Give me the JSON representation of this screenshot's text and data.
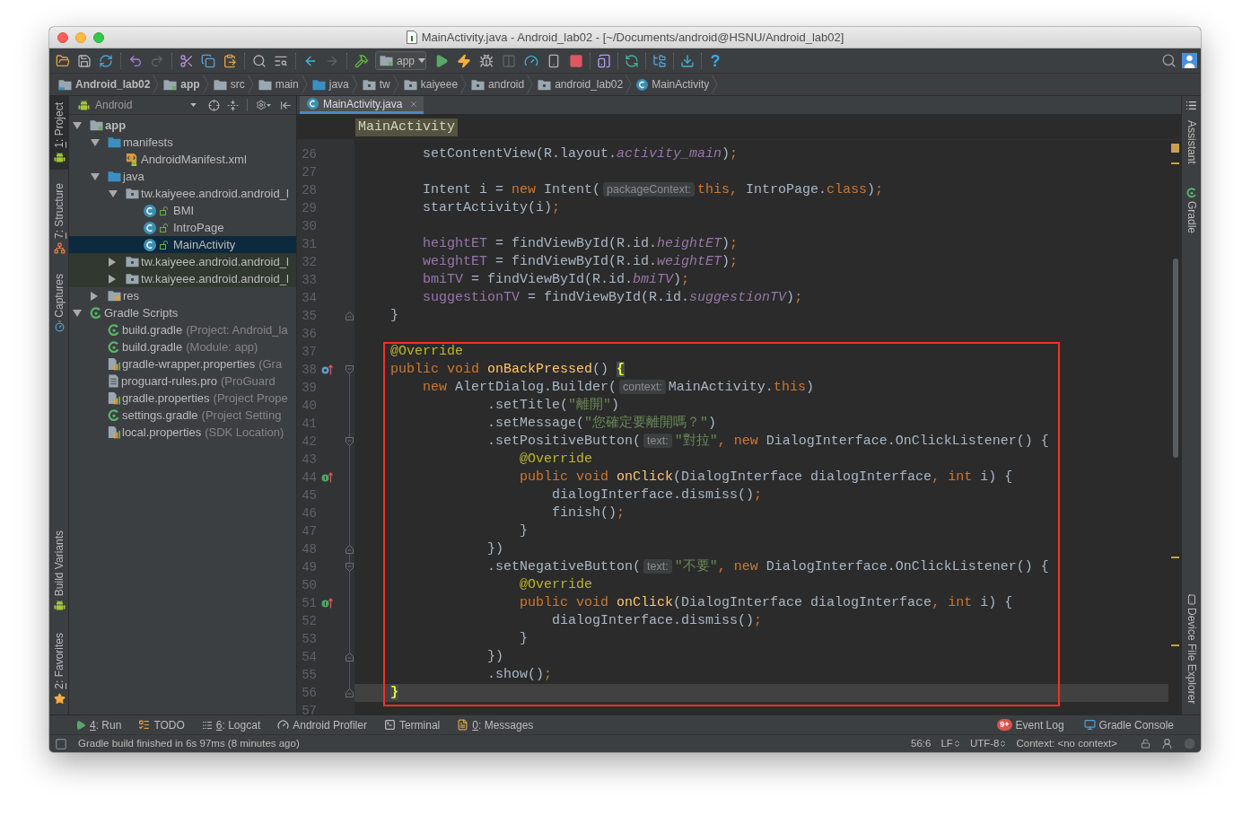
{
  "window": {
    "title": "MainActivity.java - Android_lab02 - [~/Documents/android@HSNU/Android_lab02]"
  },
  "toolbar": {
    "run_configuration": "app",
    "help": "?"
  },
  "navigation_bar": [
    {
      "kind": "project",
      "label": "Android_lab02"
    },
    {
      "kind": "module",
      "label": "app"
    },
    {
      "kind": "folder",
      "label": "src"
    },
    {
      "kind": "folder",
      "label": "main"
    },
    {
      "kind": "source-folder",
      "label": "java"
    },
    {
      "kind": "package",
      "label": "tw"
    },
    {
      "kind": "package",
      "label": "kaiyeee"
    },
    {
      "kind": "package",
      "label": "android"
    },
    {
      "kind": "package",
      "label": "android_lab02"
    },
    {
      "kind": "class",
      "label": "MainActivity"
    }
  ],
  "left_tool_strip": {
    "top": [
      {
        "kind": "project",
        "mnemonic": "1",
        "label": ": Project",
        "selected": true
      },
      {
        "kind": "structure",
        "mnemonic": "7",
        "label": ": Structure",
        "selected": false
      },
      {
        "kind": "captures",
        "label": "Captures",
        "selected": false
      }
    ],
    "bottom": [
      {
        "kind": "build-variants",
        "label": "Build Variants",
        "selected": false
      },
      {
        "kind": "favorites",
        "mnemonic": "2",
        "label": ": Favorites",
        "selected": false
      }
    ]
  },
  "project_panel": {
    "view": "Android",
    "tree": [
      {
        "kind": "module",
        "label": "app",
        "selected": false,
        "expanded": true,
        "children": [
          {
            "kind": "source-folder",
            "label": "manifests",
            "selected": false,
            "expanded": true,
            "children": [
              {
                "kind": "manifest",
                "label": "AndroidManifest.xml",
                "selected": false
              }
            ]
          },
          {
            "kind": "source-folder",
            "label": "java",
            "selected": false,
            "expanded": true,
            "children": [
              {
                "kind": "package",
                "label": "tw.kaiyeee.android.android_l",
                "selected": false,
                "expanded": true,
                "children": [
                  {
                    "kind": "class",
                    "label": "BMI",
                    "selected": false
                  },
                  {
                    "kind": "class",
                    "label": "IntroPage",
                    "selected": false
                  },
                  {
                    "kind": "class",
                    "label": "MainActivity",
                    "selected": true
                  }
                ]
              },
              {
                "kind": "test-package",
                "label": "tw.kaiyeee.android.android_l",
                "selected": false,
                "expanded": false
              },
              {
                "kind": "test-package",
                "label": "tw.kaiyeee.android.android_l",
                "selected": false,
                "expanded": false
              }
            ]
          },
          {
            "kind": "resource-folder",
            "label": "res",
            "selected": false,
            "expanded": false
          }
        ]
      },
      {
        "kind": "gradle-group",
        "label": "Gradle Scripts",
        "selected": false,
        "expanded": true,
        "children": [
          {
            "kind": "gradle",
            "label": "build.gradle",
            "note": "(Project: Android_la",
            "selected": false
          },
          {
            "kind": "gradle",
            "label": "build.gradle",
            "note": "(Module: app)",
            "selected": false
          },
          {
            "kind": "properties",
            "label": "gradle-wrapper.properties",
            "note": "(Gra",
            "selected": false
          },
          {
            "kind": "file",
            "label": "proguard-rules.pro",
            "note": "(ProGuard",
            "selected": false
          },
          {
            "kind": "properties",
            "label": "gradle.properties",
            "note": "(Project Prope",
            "selected": false
          },
          {
            "kind": "gradle",
            "label": "settings.gradle",
            "note": "(Project Setting",
            "selected": false
          },
          {
            "kind": "properties",
            "label": "local.properties",
            "note": "(SDK Location)",
            "selected": false
          }
        ]
      }
    ]
  },
  "editor": {
    "tabs": [
      {
        "label": "MainActivity.java",
        "selected": true
      }
    ],
    "header": "MainActivity",
    "lines": [
      {
        "number": "26",
        "current": false,
        "tokens": [
          {
            "kind": "text",
            "text": "        setContentView(R.layout."
          },
          {
            "kind": "static",
            "text": "activity_main"
          },
          {
            "kind": "text",
            "text": ")"
          },
          {
            "kind": "keyword",
            "text": ";"
          }
        ]
      },
      {
        "number": "27",
        "current": false
      },
      {
        "number": "28",
        "current": false,
        "tokens": [
          {
            "kind": "text",
            "text": "        Intent i = "
          },
          {
            "kind": "keyword",
            "text": "new"
          },
          {
            "kind": "text",
            "text": " Intent("
          },
          {
            "kind": "hint",
            "text": "packageContext:"
          },
          {
            "kind": "keyword",
            "text": "this,"
          },
          {
            "kind": "text",
            "text": " IntroPage."
          },
          {
            "kind": "keyword",
            "text": "class"
          },
          {
            "kind": "text",
            "text": ")"
          },
          {
            "kind": "keyword",
            "text": ";"
          }
        ]
      },
      {
        "number": "29",
        "current": false,
        "tokens": [
          {
            "kind": "text",
            "text": "        startActivity(i)"
          },
          {
            "kind": "keyword",
            "text": ";"
          }
        ]
      },
      {
        "number": "30",
        "current": false
      },
      {
        "number": "31",
        "current": false,
        "tokens": [
          {
            "kind": "field",
            "text": "        heightET"
          },
          {
            "kind": "text",
            "text": " = findViewById(R.id."
          },
          {
            "kind": "static",
            "text": "heightET"
          },
          {
            "kind": "text",
            "text": ")"
          },
          {
            "kind": "keyword",
            "text": ";"
          }
        ]
      },
      {
        "number": "32",
        "current": false,
        "tokens": [
          {
            "kind": "field",
            "text": "        weightET"
          },
          {
            "kind": "text",
            "text": " = findViewById(R.id."
          },
          {
            "kind": "static",
            "text": "weightET"
          },
          {
            "kind": "text",
            "text": ")"
          },
          {
            "kind": "keyword",
            "text": ";"
          }
        ]
      },
      {
        "number": "33",
        "current": false,
        "tokens": [
          {
            "kind": "field",
            "text": "        bmiTV"
          },
          {
            "kind": "text",
            "text": " = findViewById(R.id."
          },
          {
            "kind": "static",
            "text": "bmiTV"
          },
          {
            "kind": "text",
            "text": ")"
          },
          {
            "kind": "keyword",
            "text": ";"
          }
        ]
      },
      {
        "number": "34",
        "current": false,
        "tokens": [
          {
            "kind": "field",
            "text": "        suggestionTV"
          },
          {
            "kind": "text",
            "text": " = findViewById(R.id."
          },
          {
            "kind": "static",
            "text": "suggestionTV"
          },
          {
            "kind": "text",
            "text": ")"
          },
          {
            "kind": "keyword",
            "text": ";"
          }
        ]
      },
      {
        "number": "35",
        "current": false,
        "markers": [
          {
            "kind": "fold-end"
          }
        ],
        "tokens": [
          {
            "kind": "text",
            "text": "    }"
          }
        ]
      },
      {
        "number": "36",
        "current": false
      },
      {
        "number": "37",
        "current": false,
        "tokens": [
          {
            "kind": "annotation",
            "text": "    @Override"
          }
        ]
      },
      {
        "number": "38",
        "current": false,
        "markers": [
          {
            "kind": "overrides"
          },
          {
            "kind": "fold-start"
          }
        ],
        "tokens": [
          {
            "kind": "keyword",
            "text": "    public void "
          },
          {
            "kind": "method",
            "text": "onBackPressed"
          },
          {
            "kind": "text",
            "text": "() "
          },
          {
            "kind": "brace",
            "text": "{"
          }
        ]
      },
      {
        "number": "39",
        "current": false,
        "tokens": [
          {
            "kind": "keyword",
            "text": "        new"
          },
          {
            "kind": "text",
            "text": " AlertDialog.Builder("
          },
          {
            "kind": "hint",
            "text": "context:"
          },
          {
            "kind": "text",
            "text": "MainActivity."
          },
          {
            "kind": "keyword",
            "text": "this"
          },
          {
            "kind": "text",
            "text": ")"
          }
        ]
      },
      {
        "number": "40",
        "current": false,
        "tokens": [
          {
            "kind": "text",
            "text": "                .setTitle("
          },
          {
            "kind": "string",
            "text": "\"離開\""
          },
          {
            "kind": "text",
            "text": ")"
          }
        ]
      },
      {
        "number": "41",
        "current": false,
        "tokens": [
          {
            "kind": "text",
            "text": "                .setMessage("
          },
          {
            "kind": "string",
            "text": "\"您確定要離開嗎？\""
          },
          {
            "kind": "text",
            "text": ")"
          }
        ]
      },
      {
        "number": "42",
        "current": false,
        "markers": [
          {
            "kind": "fold-start"
          }
        ],
        "tokens": [
          {
            "kind": "text",
            "text": "                .setPositiveButton("
          },
          {
            "kind": "hint",
            "text": "text:"
          },
          {
            "kind": "string",
            "text": "\"對拉\""
          },
          {
            "kind": "keyword",
            "text": ", new"
          },
          {
            "kind": "text",
            "text": " DialogInterface.OnClickListener() {"
          }
        ]
      },
      {
        "number": "43",
        "current": false,
        "tokens": [
          {
            "kind": "annotation",
            "text": "                    @Override"
          }
        ]
      },
      {
        "number": "44",
        "current": false,
        "markers": [
          {
            "kind": "implements"
          }
        ],
        "tokens": [
          {
            "kind": "keyword",
            "text": "                    public void "
          },
          {
            "kind": "method",
            "text": "onClick"
          },
          {
            "kind": "text",
            "text": "(DialogInterface dialogInterface"
          },
          {
            "kind": "keyword",
            "text": ", int"
          },
          {
            "kind": "text",
            "text": " i) {"
          }
        ]
      },
      {
        "number": "45",
        "current": false,
        "tokens": [
          {
            "kind": "text",
            "text": "                        dialogInterface.dismiss()"
          },
          {
            "kind": "keyword",
            "text": ";"
          }
        ]
      },
      {
        "number": "46",
        "current": false,
        "tokens": [
          {
            "kind": "text",
            "text": "                        finish()"
          },
          {
            "kind": "keyword",
            "text": ";"
          }
        ]
      },
      {
        "number": "47",
        "current": false,
        "tokens": [
          {
            "kind": "text",
            "text": "                    }"
          }
        ]
      },
      {
        "number": "48",
        "current": false,
        "markers": [
          {
            "kind": "fold-end"
          }
        ],
        "tokens": [
          {
            "kind": "text",
            "text": "                })"
          }
        ]
      },
      {
        "number": "49",
        "current": false,
        "markers": [
          {
            "kind": "fold-start"
          }
        ],
        "tokens": [
          {
            "kind": "text",
            "text": "                .setNegativeButton("
          },
          {
            "kind": "hint",
            "text": "text:"
          },
          {
            "kind": "string",
            "text": "\"不要\""
          },
          {
            "kind": "keyword",
            "text": ", new"
          },
          {
            "kind": "text",
            "text": " DialogInterface.OnClickListener() {"
          }
        ]
      },
      {
        "number": "50",
        "current": false,
        "tokens": [
          {
            "kind": "annotation",
            "text": "                    @Override"
          }
        ]
      },
      {
        "number": "51",
        "current": false,
        "markers": [
          {
            "kind": "implements"
          }
        ],
        "tokens": [
          {
            "kind": "keyword",
            "text": "                    public void "
          },
          {
            "kind": "method",
            "text": "onClick"
          },
          {
            "kind": "text",
            "text": "(DialogInterface dialogInterface"
          },
          {
            "kind": "keyword",
            "text": ", int"
          },
          {
            "kind": "text",
            "text": " i) {"
          }
        ]
      },
      {
        "number": "52",
        "current": false,
        "tokens": [
          {
            "kind": "text",
            "text": "                        dialogInterface.dismiss()"
          },
          {
            "kind": "keyword",
            "text": ";"
          }
        ]
      },
      {
        "number": "53",
        "current": false,
        "tokens": [
          {
            "kind": "text",
            "text": "                    }"
          }
        ]
      },
      {
        "number": "54",
        "current": false,
        "markers": [
          {
            "kind": "fold-end"
          }
        ],
        "tokens": [
          {
            "kind": "text",
            "text": "                })"
          }
        ]
      },
      {
        "number": "55",
        "current": false,
        "tokens": [
          {
            "kind": "text",
            "text": "                .show()"
          },
          {
            "kind": "keyword",
            "text": ";"
          }
        ]
      },
      {
        "number": "56",
        "current": true,
        "markers": [
          {
            "kind": "fold-end"
          }
        ],
        "tokens": [
          {
            "kind": "brace",
            "text": "    }"
          }
        ]
      },
      {
        "number": "57",
        "current": false
      }
    ]
  },
  "right_tool_strip": {
    "top": [
      {
        "kind": "assistant",
        "label": "Assistant"
      },
      {
        "kind": "gradle",
        "label": "Gradle"
      }
    ],
    "bottom": [
      {
        "kind": "device-explorer",
        "label": "Device File Explorer"
      }
    ]
  },
  "tool_window_bar": {
    "left": [
      {
        "kind": "run",
        "mnemonic": "4",
        "label": ": Run"
      },
      {
        "kind": "todo",
        "label": "TODO"
      },
      {
        "kind": "logcat",
        "mnemonic": "6",
        "label": ": Logcat"
      },
      {
        "kind": "profiler",
        "label": "Android Profiler"
      },
      {
        "kind": "terminal",
        "label": "Terminal"
      },
      {
        "kind": "messages",
        "mnemonic": "0",
        "label": ": Messages"
      }
    ],
    "right": [
      {
        "kind": "event-log",
        "badge": "9+",
        "label": "Event Log"
      },
      {
        "kind": "gradle-console",
        "label": "Gradle Console"
      }
    ]
  },
  "status_bar": {
    "message": "Gradle build finished in 6s 97ms (8 minutes ago)",
    "caret_position": "56:6",
    "line_separator": "LF",
    "encoding": "UTF-8",
    "context": "Context: <no context>"
  }
}
